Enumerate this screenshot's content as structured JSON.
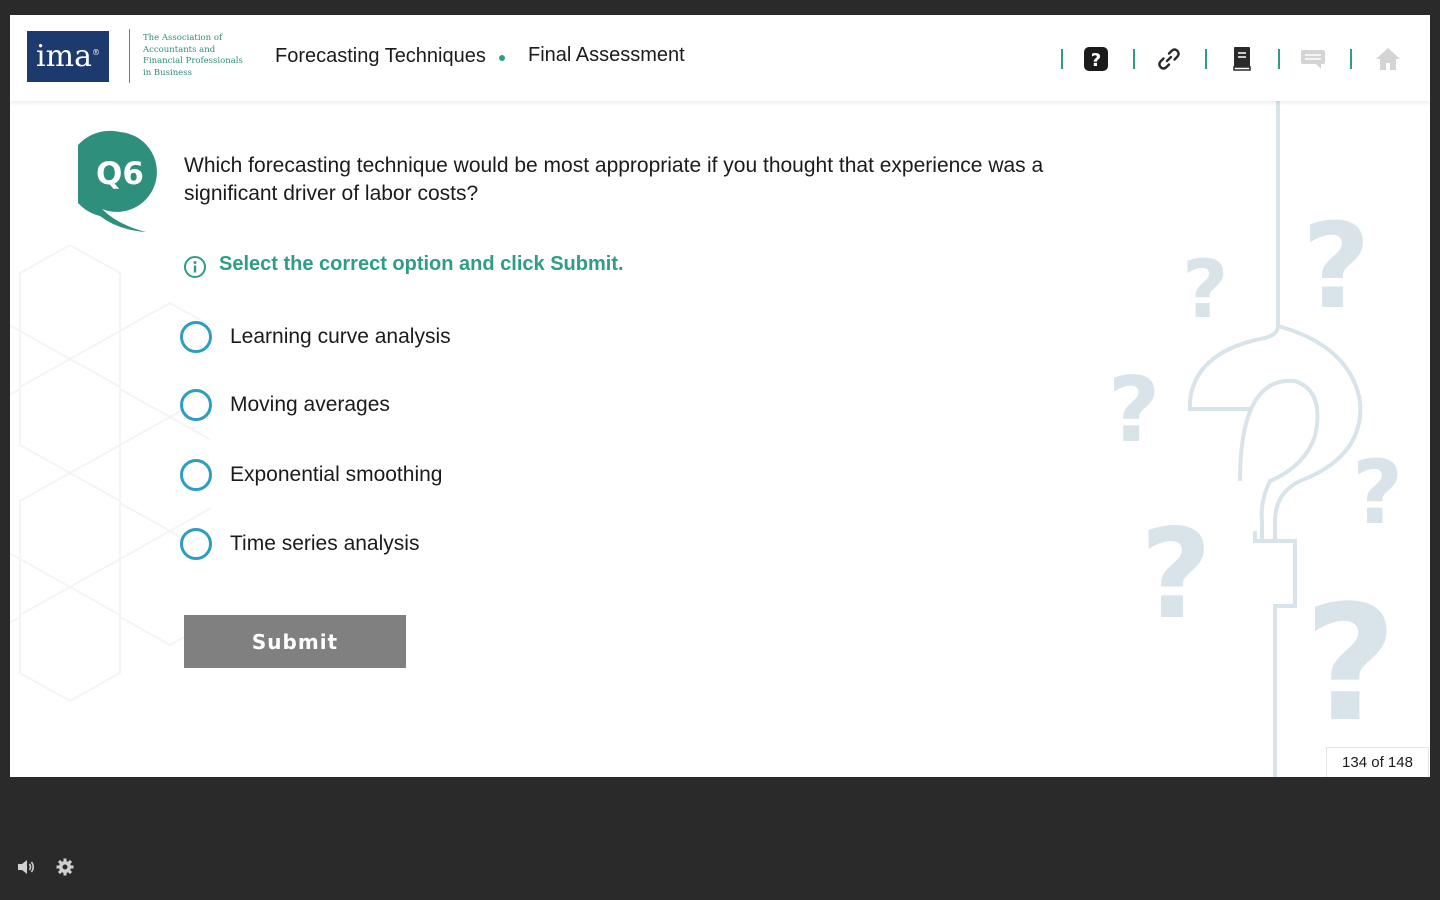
{
  "header": {
    "logo_text": "ima",
    "logo_mark": "®",
    "org_lines": [
      "The Association of",
      "Accountants and",
      "Financial Professionals",
      "in Business"
    ],
    "course_title": "Forecasting Techniques",
    "section_title": "Final Assessment",
    "toolbar_icons": [
      "help-icon",
      "link-icon",
      "book-icon",
      "comments-icon",
      "home-icon"
    ]
  },
  "question": {
    "badge": "Q6",
    "text": "Which forecasting technique would be most appropriate if you thought that experience was a significant driver of labor costs?",
    "instruction": "Select the correct option and click Submit.",
    "options": [
      "Learning curve analysis",
      "Moving averages",
      "Exponential smoothing",
      "Time series analysis"
    ],
    "submit_label": "Submit"
  },
  "page_counter": "134 of 148",
  "colors": {
    "accent": "#2e9d86",
    "radio": "#2f9cc1",
    "logo_bg": "#1d3a6e",
    "submit_bg": "#808080",
    "player_bg": "#2a2a2a"
  },
  "footer_icons": [
    "volume-icon",
    "settings-gear-icon"
  ]
}
